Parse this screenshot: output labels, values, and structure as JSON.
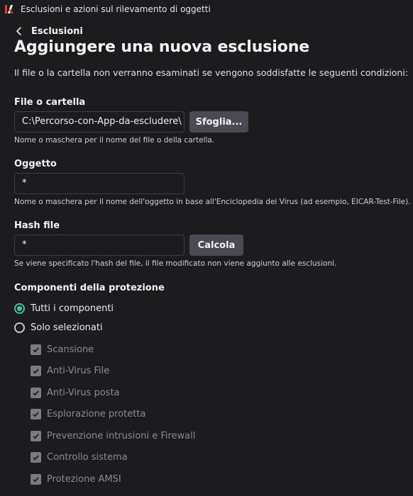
{
  "window": {
    "title": "Esclusioni e azioni sul rilevamento di oggetti",
    "app_icon": "kaspersky-k-logo-icon"
  },
  "nav": {
    "back_label": "Esclusioni"
  },
  "page": {
    "title": "Aggiungere una nuova esclusione",
    "subtitle": "Il file o la cartella non verranno esaminati se vengono soddisfatte le seguenti condizioni:"
  },
  "file_folder": {
    "label": "File o cartella",
    "value": "C:\\Percorso-con-App-da-escludere\\",
    "button": "Sfoglia...",
    "hint": "Nome o maschera per il nome del file o della cartella."
  },
  "object": {
    "label": "Oggetto",
    "value": "*",
    "hint": "Nome o maschera per il nome dell'oggetto in base all'Enciclopedia dei Virus (ad esempio, EICAR-Test-File)."
  },
  "hash": {
    "label": "Hash file",
    "value": "*",
    "button": "Calcola",
    "hint": "Se viene specificato l'hash del file, il file modificato non viene aggiunto alle esclusioni."
  },
  "components": {
    "label": "Componenti della protezione",
    "radios": [
      {
        "label": "Tutti i componenti",
        "checked": true
      },
      {
        "label": "Solo selezionati",
        "checked": false
      }
    ],
    "items": [
      {
        "label": "Scansione",
        "checked": true,
        "disabled": true
      },
      {
        "label": "Anti-Virus File",
        "checked": true,
        "disabled": true
      },
      {
        "label": "Anti-Virus posta",
        "checked": true,
        "disabled": true
      },
      {
        "label": "Esplorazione protetta",
        "checked": true,
        "disabled": true
      },
      {
        "label": "Prevenzione intrusioni e Firewall",
        "checked": true,
        "disabled": true
      },
      {
        "label": "Controllo sistema",
        "checked": true,
        "disabled": true
      },
      {
        "label": "Protezione AMSI",
        "checked": true,
        "disabled": true
      }
    ]
  },
  "colors": {
    "background": "#1c1c1f",
    "accent": "#3fc59b",
    "button": "#4a4a52",
    "field_border": "#3e3e44",
    "disabled_text": "#8a8a90"
  }
}
